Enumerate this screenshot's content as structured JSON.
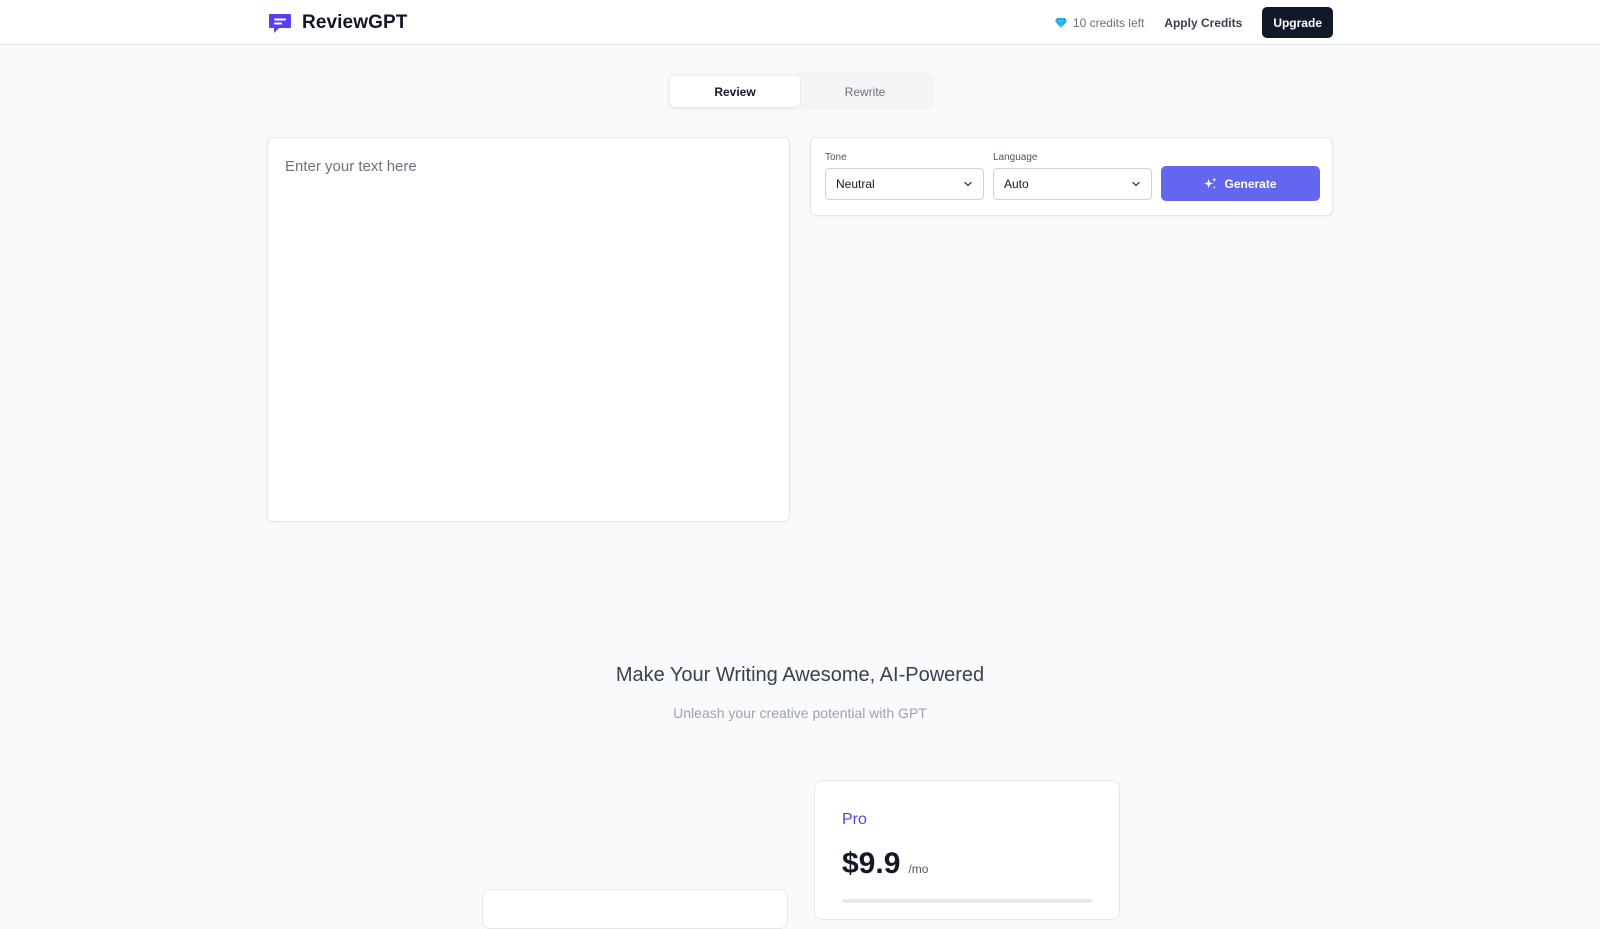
{
  "header": {
    "brand_name": "ReviewGPT",
    "logo_icon": "chat-message-icon",
    "credits_text": "10 credits left",
    "apply_credits_label": "Apply Credits",
    "upgrade_label": "Upgrade"
  },
  "tabs": [
    {
      "label": "Review",
      "active": true
    },
    {
      "label": "Rewrite",
      "active": false
    }
  ],
  "editor": {
    "placeholder": "Enter your text here",
    "value": ""
  },
  "controls": {
    "tone": {
      "label": "Tone",
      "value": "Neutral"
    },
    "language": {
      "label": "Language",
      "value": "Auto"
    },
    "generate_label": "Generate"
  },
  "marketing": {
    "title": "Make Your Writing Awesome, AI-Powered",
    "subtitle": "Unleash your creative potential with GPT"
  },
  "pricing": {
    "pro": {
      "name": "Pro",
      "price": "$9.9",
      "period": "/mo"
    }
  },
  "colors": {
    "accent": "#6366f1",
    "brand": "#4f46e5",
    "dark": "#111827",
    "diamond": "#0ea5e9"
  }
}
